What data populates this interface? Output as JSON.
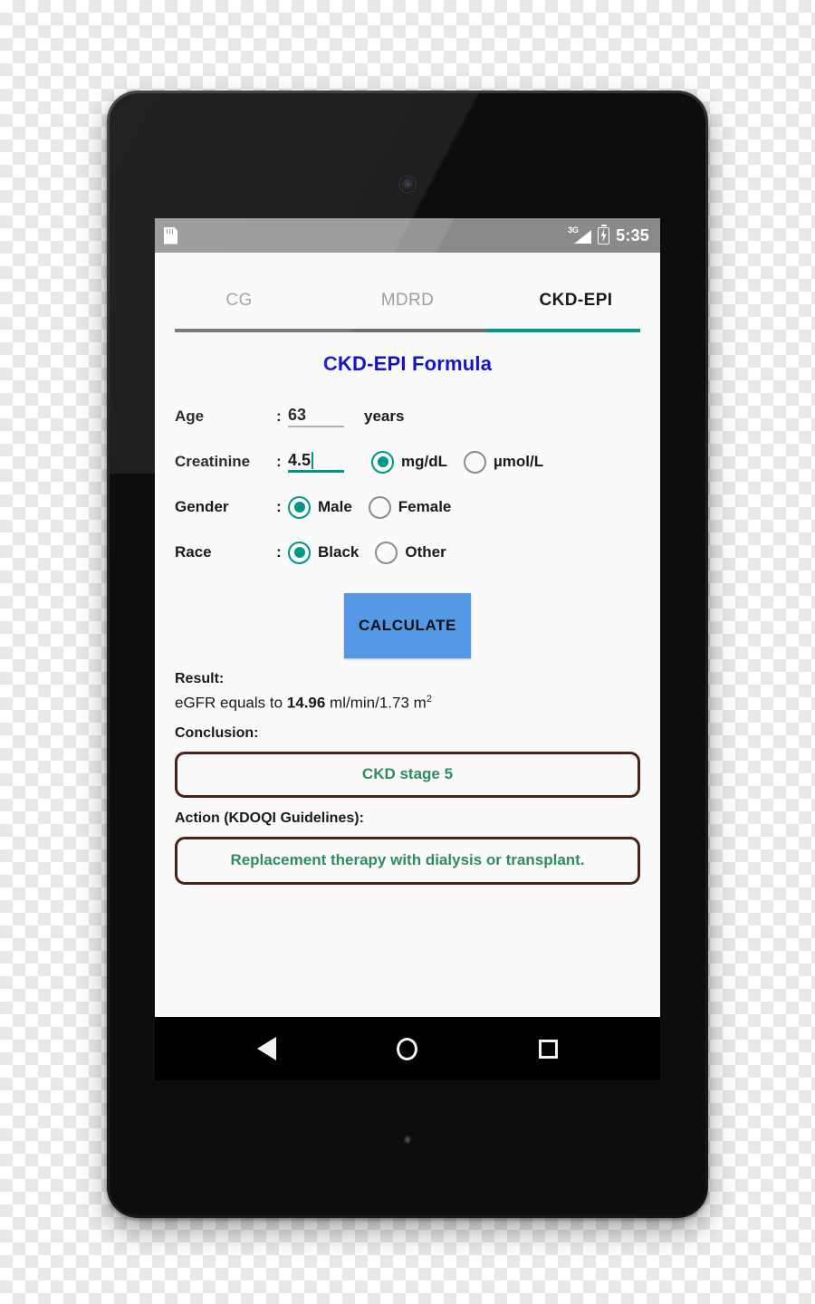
{
  "status_bar": {
    "sd_icon": "sd-card-icon",
    "network_label": "3G",
    "signal_icon": "signal-bars-icon",
    "battery_icon": "battery-charging-icon",
    "clock": "5:35"
  },
  "tabs": [
    {
      "label": "CG",
      "active": false
    },
    {
      "label": "MDRD",
      "active": false
    },
    {
      "label": "CKD-EPI",
      "active": true
    }
  ],
  "form": {
    "title": "CKD-EPI Formula",
    "colon": ":",
    "age": {
      "label": "Age",
      "value": "63",
      "unit": "years",
      "focused": false
    },
    "creatinine": {
      "label": "Creatinine",
      "value": "4.5",
      "focused": true,
      "units": [
        {
          "label": "mg/dL",
          "selected": true
        },
        {
          "label": "µmol/L",
          "selected": false
        }
      ]
    },
    "gender": {
      "label": "Gender",
      "options": [
        {
          "label": "Male",
          "selected": true
        },
        {
          "label": "Female",
          "selected": false
        }
      ]
    },
    "race": {
      "label": "Race",
      "options": [
        {
          "label": "Black",
          "selected": true
        },
        {
          "label": "Other",
          "selected": false
        }
      ]
    },
    "calculate_label": "CALCULATE"
  },
  "result": {
    "label": "Result:",
    "prefix": "eGFR equals to ",
    "value": "14.96",
    "units": " ml/min/1.73 m",
    "units_sup": "2"
  },
  "conclusion": {
    "label": "Conclusion:",
    "text": "CKD stage 5"
  },
  "action": {
    "label": "Action (KDOQI Guidelines):",
    "text": "Replacement therapy with dialysis or transplant."
  },
  "nav_bar": {
    "back": "back-triangle-icon",
    "home": "home-circle-icon",
    "recents": "recents-square-icon"
  },
  "colors": {
    "accent_teal": "#009688",
    "title_blue": "#1414cc",
    "button_blue": "#5599e6",
    "box_border_brown": "#4a2318",
    "box_text_green": "#2e8b63",
    "status_bar_gray": "#8a8a8a",
    "screen_background": "#fafafa",
    "tab_inactive_gray": "#9e9e9e"
  }
}
